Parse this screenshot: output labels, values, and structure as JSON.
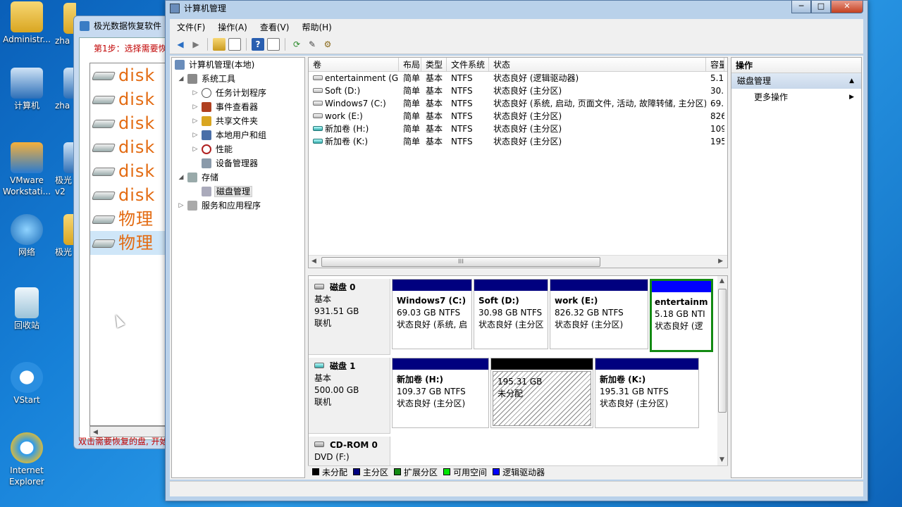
{
  "desktop": {
    "icons": [
      {
        "label": "Administr..."
      },
      {
        "label": "计算机"
      },
      {
        "label": "VMware Workstati..."
      },
      {
        "label": "网络"
      },
      {
        "label": "回收站"
      },
      {
        "label": "VStart"
      },
      {
        "label": "Internet Explorer"
      }
    ],
    "partial_icons": [
      {
        "label": "zha"
      },
      {
        "label": "zha"
      },
      {
        "label": "极光"
      },
      {
        "label": "v2"
      },
      {
        "label": "极光"
      }
    ]
  },
  "bg_app": {
    "title": "极光数据恢复软件",
    "step_text": "第1步：选择需要恢",
    "rows": [
      "disk",
      "disk",
      "disk",
      "disk",
      "disk",
      "disk",
      "物理",
      "物理"
    ],
    "status_text": "双击需要恢复的盘, 开始"
  },
  "window": {
    "title": "计算机管理",
    "controls": {
      "min": "─",
      "max": "□",
      "close": "✕"
    },
    "menu": [
      "文件(F)",
      "操作(A)",
      "查看(V)",
      "帮助(H)"
    ]
  },
  "tree": {
    "root": "计算机管理(本地)",
    "system_tools": "系统工具",
    "items": [
      "任务计划程序",
      "事件查看器",
      "共享文件夹",
      "本地用户和组",
      "性能",
      "设备管理器"
    ],
    "storage": "存储",
    "disk_mgmt": "磁盘管理",
    "services": "服务和应用程序"
  },
  "volumes": {
    "headers": [
      "卷",
      "布局",
      "类型",
      "文件系统",
      "状态",
      "容量"
    ],
    "rows": [
      {
        "name": "entertainment (G:)",
        "layout": "简单",
        "type": "基本",
        "fs": "NTFS",
        "status": "状态良好 (逻辑驱动器)",
        "cap": "5.1",
        "icon": "g"
      },
      {
        "name": "Soft (D:)",
        "layout": "简单",
        "type": "基本",
        "fs": "NTFS",
        "status": "状态良好 (主分区)",
        "cap": "30.",
        "icon": "g"
      },
      {
        "name": "Windows7 (C:)",
        "layout": "简单",
        "type": "基本",
        "fs": "NTFS",
        "status": "状态良好 (系统, 启动, 页面文件, 活动, 故障转储, 主分区)",
        "cap": "69.",
        "icon": "g"
      },
      {
        "name": "work (E:)",
        "layout": "简单",
        "type": "基本",
        "fs": "NTFS",
        "status": "状态良好 (主分区)",
        "cap": "826",
        "icon": "g"
      },
      {
        "name": "新加卷 (H:)",
        "layout": "简单",
        "type": "基本",
        "fs": "NTFS",
        "status": "状态良好 (主分区)",
        "cap": "109",
        "icon": "b"
      },
      {
        "name": "新加卷 (K:)",
        "layout": "简单",
        "type": "基本",
        "fs": "NTFS",
        "status": "状态良好 (主分区)",
        "cap": "195",
        "icon": "b"
      }
    ],
    "scroll_grip": "III"
  },
  "disks": [
    {
      "name": "磁盘 0",
      "kind": "基本",
      "size": "931.51 GB",
      "state": "联机",
      "parts": [
        {
          "name": "Windows7  (C:)",
          "size": "69.03 GB NTFS",
          "status": "状态良好 (系统, 启"
        },
        {
          "name": "Soft  (D:)",
          "size": "30.98 GB NTFS",
          "status": "状态良好 (主分区"
        },
        {
          "name": "work  (E:)",
          "size": "826.32 GB NTFS",
          "status": "状态良好 (主分区)"
        },
        {
          "name": "entertainm",
          "size": "5.18 GB NTI",
          "status": "状态良好 (逻"
        }
      ]
    },
    {
      "name": "磁盘 1",
      "kind": "基本",
      "size": "500.00 GB",
      "state": "联机",
      "parts": [
        {
          "name": "新加卷  (H:)",
          "size": "109.37 GB NTFS",
          "status": "状态良好 (主分区)"
        },
        {
          "name": "",
          "size": "195.31 GB",
          "status": "未分配"
        },
        {
          "name": "新加卷  (K:)",
          "size": "195.31 GB NTFS",
          "status": "状态良好 (主分区)"
        }
      ]
    },
    {
      "name": "CD-ROM 0",
      "kind": "DVD (F:)"
    }
  ],
  "legend": [
    {
      "label": "未分配",
      "color": "#000000"
    },
    {
      "label": "主分区",
      "color": "#00007f"
    },
    {
      "label": "扩展分区",
      "color": "#138a13"
    },
    {
      "label": "可用空间",
      "color": "#00e600"
    },
    {
      "label": "逻辑驱动器",
      "color": "#0000ff"
    }
  ],
  "actions": {
    "header": "操作",
    "section": "磁盘管理",
    "more": "更多操作"
  }
}
